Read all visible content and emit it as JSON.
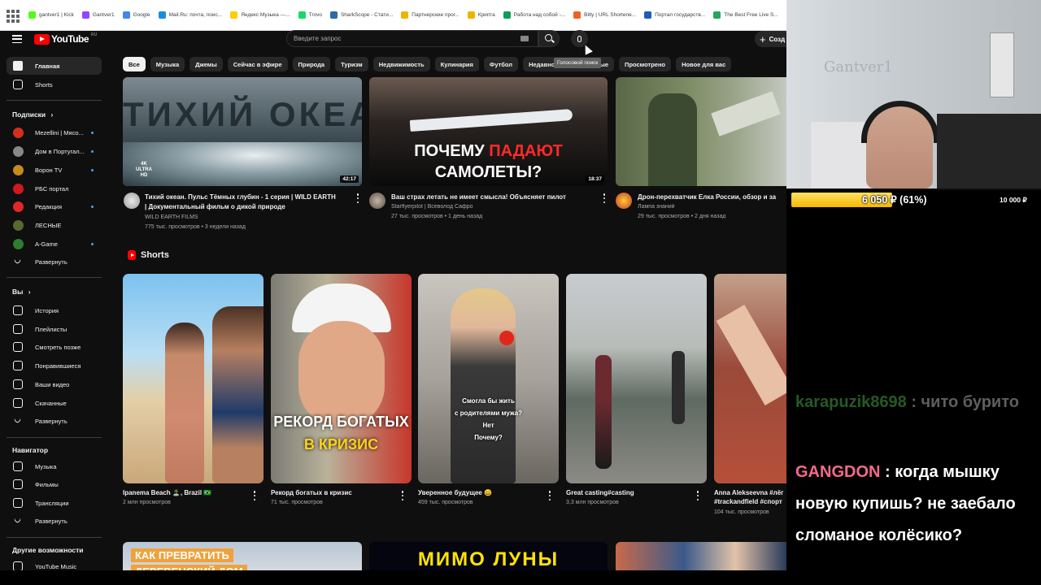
{
  "browser": {
    "bookmarks": [
      {
        "label": "gantver1 | Kick",
        "color": "#53fc18"
      },
      {
        "label": "Gantver1",
        "color": "#9146ff"
      },
      {
        "label": "Google",
        "color": "#4285f4"
      },
      {
        "label": "Mail.Ru: почта, поис...",
        "color": "#168de2"
      },
      {
        "label": "Яндекс Музыка —...",
        "color": "#ffcc00"
      },
      {
        "label": "Trovo",
        "color": "#19d66b"
      },
      {
        "label": "SharkScope - Стати...",
        "color": "#2b6ca3"
      },
      {
        "label": "Партнерские прог...",
        "color": "#f0b400"
      },
      {
        "label": "Крипта",
        "color": "#f0b400"
      },
      {
        "label": "Работа над собой -...",
        "color": "#0f9d58"
      },
      {
        "label": "Bitly | URL Shortene...",
        "color": "#ee6123"
      },
      {
        "label": "Портал государств...",
        "color": "#1e5cb8"
      },
      {
        "label": "The Best Free Live S...",
        "color": "#26a65b"
      }
    ]
  },
  "youtube": {
    "logo_text": "YouTube",
    "logo_region": "RU",
    "search_placeholder": "Введите запрос",
    "mic_tooltip": "Голосовой поиск",
    "create_label": "Созд",
    "chips": [
      "Все",
      "Музыка",
      "Джемы",
      "Сейчас в эфире",
      "Природа",
      "Туризм",
      "Недвижимость",
      "Кулинария",
      "Футбол",
      "Недавно опубликованные",
      "Просмотрено",
      "Новое для вас"
    ],
    "sidebar": {
      "main": [
        {
          "label": "Главная",
          "icon": "home-icon"
        },
        {
          "label": "Shorts",
          "icon": "shorts-icon"
        }
      ],
      "subscriptions_title": "Подписки",
      "subscriptions": [
        {
          "label": "Mezellini | Мясо...",
          "color": "#d2301c",
          "dot": true
        },
        {
          "label": "Дом в Португал...",
          "color": "#888888",
          "dot": true
        },
        {
          "label": "Ворон TV",
          "color": "#c88a1c",
          "dot": true
        },
        {
          "label": "РБС портал",
          "color": "#d0191f",
          "dot": false
        },
        {
          "label": "Редакция",
          "color": "#e0282a",
          "dot": true
        },
        {
          "label": "ЛЕСНЫЕ",
          "color": "#556b2f",
          "dot": false
        },
        {
          "label": "A-Game",
          "color": "#2e7d32",
          "dot": true
        }
      ],
      "expand_label": "Развернуть",
      "you_title": "Вы",
      "you_items": [
        {
          "label": "История",
          "icon": "history-icon"
        },
        {
          "label": "Плейлисты",
          "icon": "playlists-icon"
        },
        {
          "label": "Смотреть позже",
          "icon": "watch-later-icon"
        },
        {
          "label": "Понравившиеся",
          "icon": "like-icon"
        },
        {
          "label": "Ваши видео",
          "icon": "your-videos-icon"
        },
        {
          "label": "Скачанные",
          "icon": "download-icon"
        },
        {
          "label": "Развернуть",
          "icon": "chevron-down-icon"
        }
      ],
      "navigator_title": "Навигатор",
      "navigator_items": [
        {
          "label": "Музыка",
          "icon": "music-icon"
        },
        {
          "label": "Фильмы",
          "icon": "movies-icon"
        },
        {
          "label": "Трансляции",
          "icon": "live-icon"
        },
        {
          "label": "Развернуть",
          "icon": "chevron-down-icon"
        }
      ],
      "more_title": "Другие возможности",
      "more_items": [
        {
          "label": "YouTube Music",
          "icon": "youtube-music-icon"
        }
      ]
    },
    "videos": [
      {
        "title": "Тихий океан. Пульс Тёмных глубин - 1 серия  | WILD EARTH | Документальный фильм о дикой природе",
        "title_line1": "Тихий океан. Пульс Тёмных глубин - 1 серия  | WILD EARTH",
        "title_line2": "| Документальный фильм о дикой природе",
        "channel": "WILD EARTH FILMS",
        "meta": "775 тыс. просмотров • 3 недели назад",
        "duration": "42:17",
        "thumb_text": "ТИХИЙ ОКЕАН",
        "badge": "4K ULTRA HD"
      },
      {
        "title": "Ваш страх летать не имеет смысла! Объясняет пилот",
        "channel": "Starflyerpilot | Всеволод Сафро",
        "meta": "27 тыс. просмотров • 1 день назад",
        "duration": "18:37",
        "thumb_line1_a": "ПОЧЕМУ ",
        "thumb_line1_b": "ПАДАЮТ",
        "thumb_line2": "САМОЛЕТЫ?"
      },
      {
        "title": "Дрон-перехватчик Елка России, обзор и за",
        "channel": "Лампа знаний",
        "meta": "29 тыс. просмотров • 2 дня назад"
      }
    ],
    "shorts_title": "Shorts",
    "shorts": [
      {
        "title": "Ipanema Beach 🏝️, Brazil 🇧🇷",
        "meta": "2 млн просмотров"
      },
      {
        "title": "Рекорд богатых в кризис",
        "meta": "71 тыс. просмотров",
        "thumb_line1": "РЕКОРД БОГАТЫХ",
        "thumb_line2": "В КРИЗИС"
      },
      {
        "title": "Уверенное будущее 😄",
        "meta": "459 тыс. просмотров",
        "subtitle1": "Смогла бы жить",
        "subtitle2": "с родителями мужа?",
        "subtitle3": "Нет",
        "subtitle4": "Почему?"
      },
      {
        "title": "Great casting#casting",
        "meta": "3,3 млн просмотров"
      },
      {
        "title": "Anna Alekseevna #лёг",
        "title2": "#trackandfield #спорт",
        "meta": "104 тыс. просмотров"
      }
    ],
    "bottom_row": [
      {
        "thumb_line1": "КАК ПРЕВРАТИТЬ",
        "thumb_line2": "ДЕРЕВЕНСКИЙ ДОМ"
      },
      {
        "thumb_text": "МИМО ЛУНЫ"
      },
      {
        "thumb_text": ""
      }
    ]
  },
  "stream": {
    "wall_text": "Gantver1",
    "donation_amount": "6 050 ₽ (61%)",
    "donation_progress": 0.61,
    "donation_goal": "10 000 ₽",
    "chat": [
      {
        "nick": "karapuzik8698",
        "message": " : чито бурито",
        "nick_color": "#3f8a3f",
        "faded": true
      },
      {
        "nick": "GANGDON",
        "message": " : когда мышку новую купишь? не заебало сломаное колёсико?",
        "nick_color": "#f36b8b",
        "faded": false
      }
    ]
  },
  "colors": {
    "yt_bg": "#0f0f0f",
    "yt_red": "#ff0000",
    "chip_active": "#f1f1f1",
    "donation_bar": "#f5b800"
  }
}
